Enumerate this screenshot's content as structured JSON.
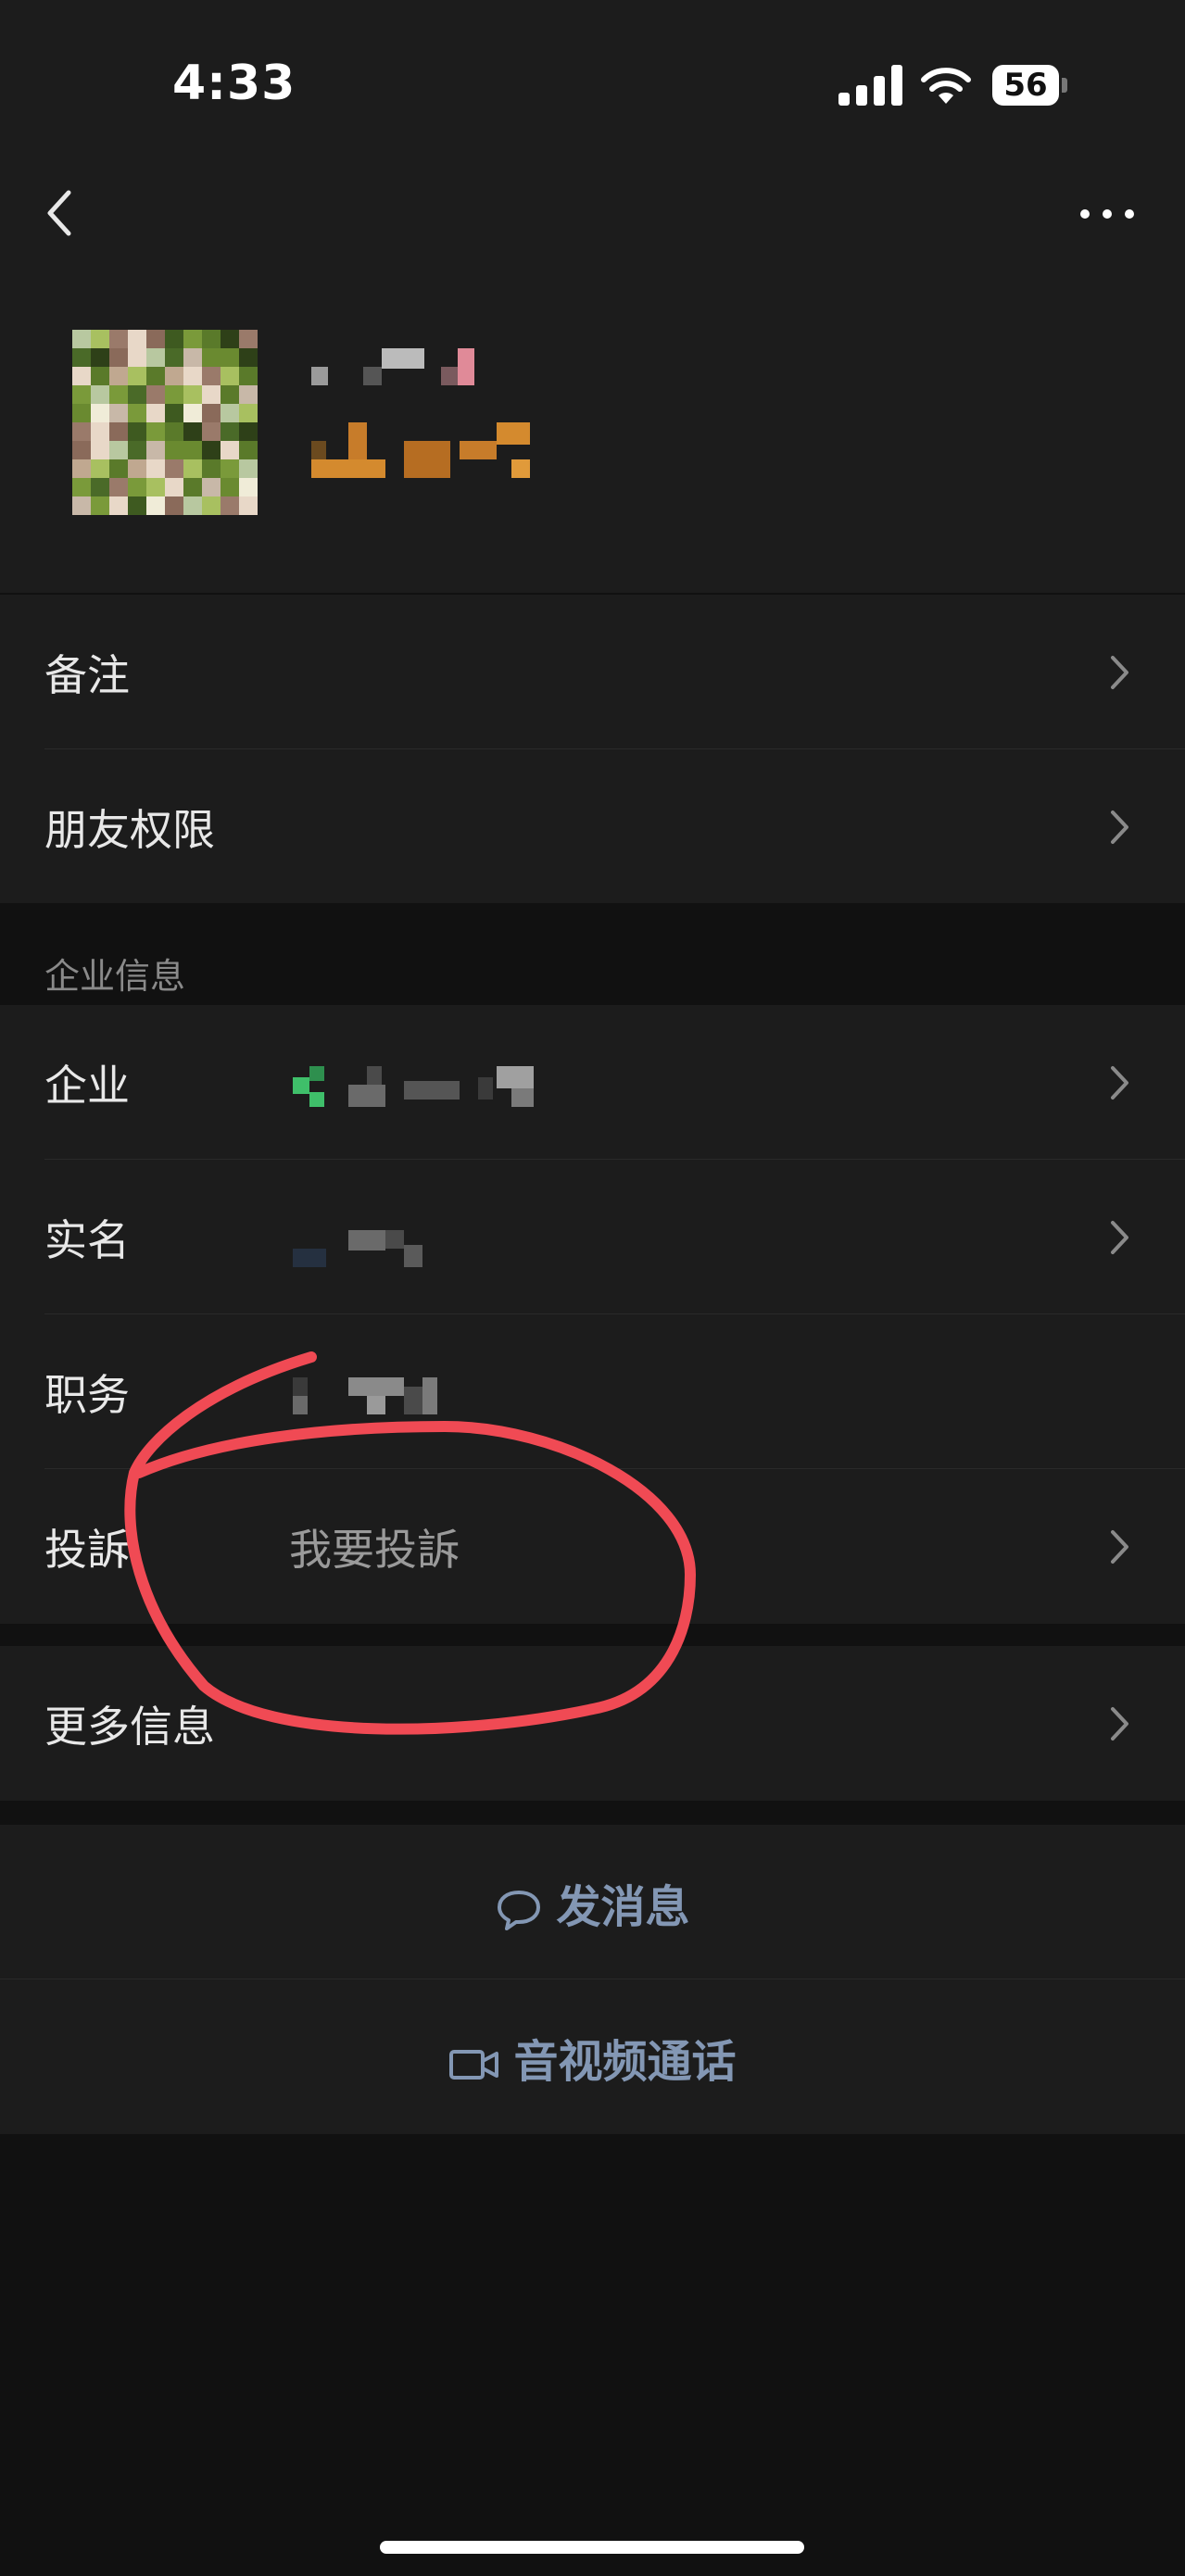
{
  "status_bar": {
    "time": "4:33",
    "battery": "56"
  },
  "rows_top": [
    {
      "label": "备注"
    },
    {
      "label": "朋友权限"
    }
  ],
  "section": {
    "title": "企业信息"
  },
  "rows_enterprise": [
    {
      "label": "企业"
    },
    {
      "label": "实名"
    },
    {
      "label": "职务"
    },
    {
      "label": "投訴",
      "value": "我要投訴"
    }
  ],
  "row_more": {
    "label": "更多信息"
  },
  "actions": {
    "message": "发消息",
    "call": "音视频通话"
  },
  "colors": {
    "background": "#111111",
    "cell": "#1c1c1c",
    "action_text": "#8397b4",
    "annotation": "#f04a54"
  },
  "icons": [
    "back-icon",
    "more-icon",
    "chevron-right-icon",
    "chat-bubble-icon",
    "video-camera-icon",
    "signal-icon",
    "wifi-icon",
    "battery-icon"
  ]
}
